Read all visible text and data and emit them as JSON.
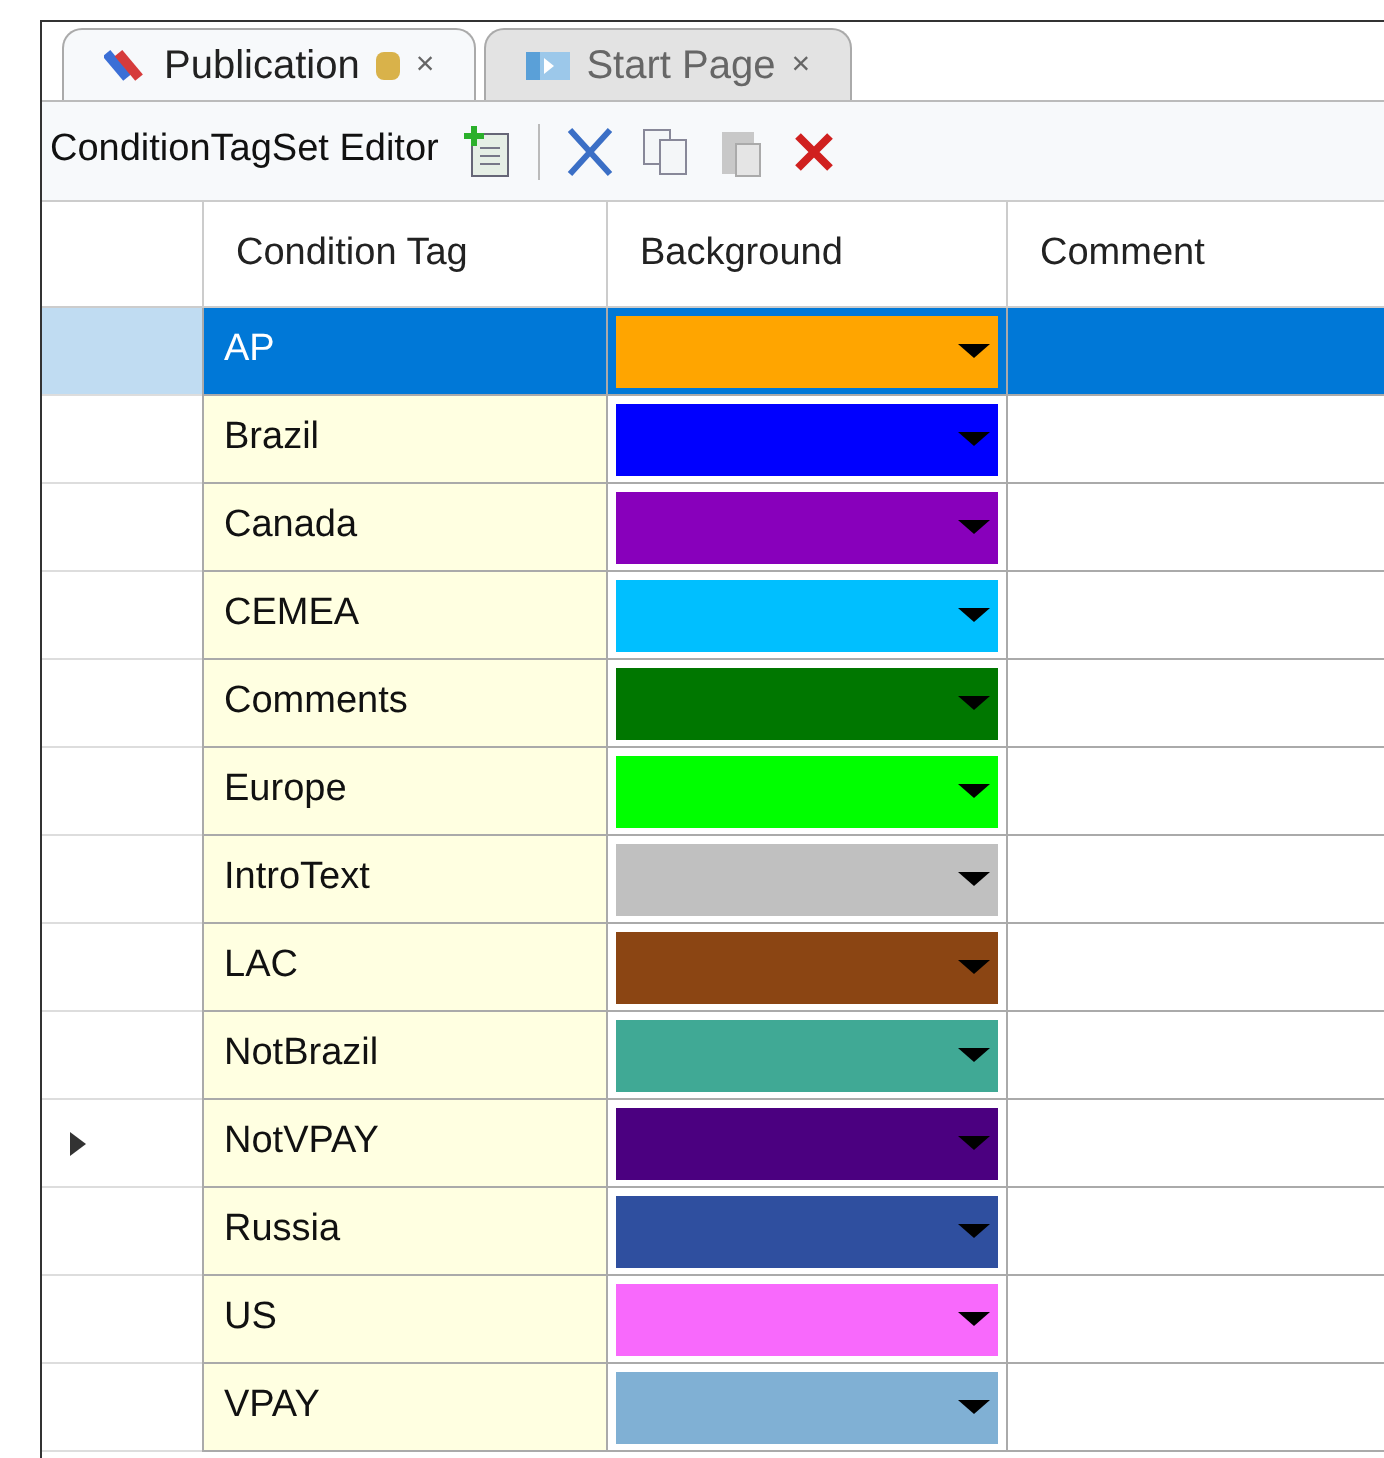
{
  "tabs": [
    {
      "label": "Publication",
      "close": "×",
      "selected": true,
      "kind": "publication"
    },
    {
      "label": "Start Page",
      "close": "×",
      "selected": false,
      "kind": "start"
    }
  ],
  "toolbar": {
    "title": "ConditionTagSet Editor"
  },
  "table": {
    "columns": [
      "Condition Tag",
      "Background",
      "Comment"
    ],
    "rows": [
      {
        "tag": "AP",
        "color": "#ffa500",
        "selected": true,
        "current": false
      },
      {
        "tag": "Brazil",
        "color": "#0000ff",
        "selected": false,
        "current": false
      },
      {
        "tag": "Canada",
        "color": "#8800bb",
        "selected": false,
        "current": false
      },
      {
        "tag": "CEMEA",
        "color": "#00bfff",
        "selected": false,
        "current": false
      },
      {
        "tag": "Comments",
        "color": "#007700",
        "selected": false,
        "current": false
      },
      {
        "tag": "Europe",
        "color": "#00ff00",
        "selected": false,
        "current": false
      },
      {
        "tag": "IntroText",
        "color": "#c0c0c0",
        "selected": false,
        "current": false
      },
      {
        "tag": "LAC",
        "color": "#8b4513",
        "selected": false,
        "current": false
      },
      {
        "tag": "NotBrazil",
        "color": "#40a995",
        "selected": false,
        "current": false
      },
      {
        "tag": "NotVPAY",
        "color": "#4b0080",
        "selected": false,
        "current": true
      },
      {
        "tag": "Russia",
        "color": "#2f4f9f",
        "selected": false,
        "current": false
      },
      {
        "tag": "US",
        "color": "#f869fc",
        "selected": false,
        "current": false
      },
      {
        "tag": "VPAY",
        "color": "#80b0d4",
        "selected": false,
        "current": false
      }
    ]
  }
}
